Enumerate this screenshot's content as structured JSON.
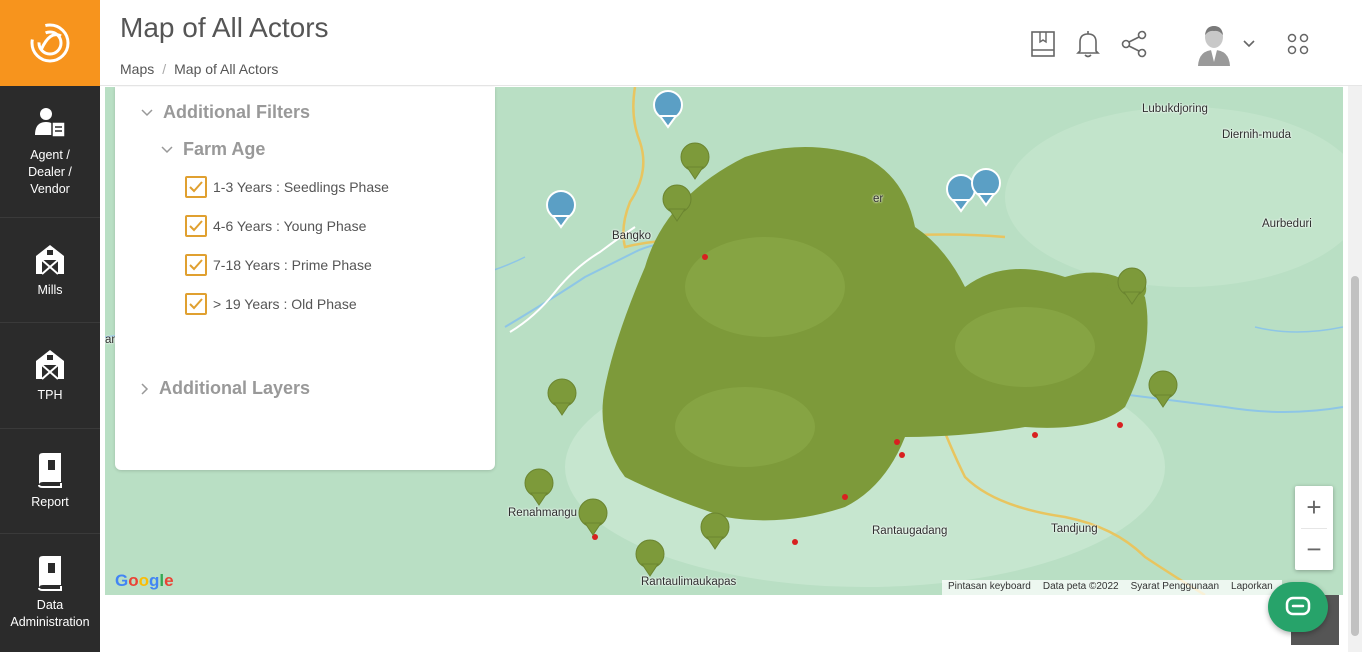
{
  "colors": {
    "brand_orange": "#f7941d",
    "sidebar_bg": "#2b2b2b",
    "marker_green": "#7d9a3a",
    "chat_green": "#27a36a",
    "map_bg": "#b9dfc4",
    "checkbox_orange": "#e0a030"
  },
  "logo_icon": "brand-logo-icon",
  "sidebar": {
    "items": [
      {
        "label": "Agent / Dealer / Vendor",
        "lines": [
          "Agent /",
          "Dealer /",
          "Vendor"
        ],
        "icon": "agent-icon"
      },
      {
        "label": "Mills",
        "icon": "barn-icon"
      },
      {
        "label": "TPH",
        "icon": "barn-icon"
      },
      {
        "label": "Report",
        "icon": "report-icon"
      },
      {
        "label": "Data Administration",
        "lines": [
          "Data",
          "Administration"
        ],
        "icon": "data-icon"
      }
    ]
  },
  "header": {
    "title": "Map of All Actors",
    "breadcrumb": [
      "Maps",
      "Map of All Actors"
    ],
    "breadcrumb_separator": "/",
    "icons": [
      "book-icon",
      "bell-icon",
      "share-icon",
      "avatar",
      "chevron-down-icon",
      "apps-grid-icon"
    ]
  },
  "filters": {
    "additional_filters": {
      "label": "Additional Filters",
      "expanded": true
    },
    "farm_age": {
      "label": "Farm Age",
      "expanded": true,
      "options": [
        {
          "label": "1-3 Years : Seedlings Phase",
          "checked": true
        },
        {
          "label": "4-6 Years : Young Phase",
          "checked": true
        },
        {
          "label": "7-18 Years : Prime Phase",
          "checked": true
        },
        {
          "label": "> 19 Years : Old Phase",
          "checked": true
        }
      ]
    },
    "additional_layers": {
      "label": "Additional Layers",
      "expanded": false
    }
  },
  "map": {
    "places": [
      {
        "name": "Lubukdjoring"
      },
      {
        "name": "Diernih-muda"
      },
      {
        "name": "Aurbeduri"
      },
      {
        "name": "Bangko"
      },
      {
        "name": "Renahmangu"
      },
      {
        "name": "Rantaugadang"
      },
      {
        "name": "Tandjung"
      },
      {
        "name": "Rantaulimaukapas"
      },
      {
        "name": "an"
      },
      {
        "name": "er"
      }
    ],
    "zoom_in_label": "+",
    "zoom_out_label": "−",
    "google_logo": "Google",
    "attribution": [
      "Pintasan keyboard",
      "Data peta ©2022",
      "Syarat Penggunaan",
      "Laporkan"
    ]
  },
  "chat": {
    "icon": "chat-icon"
  }
}
